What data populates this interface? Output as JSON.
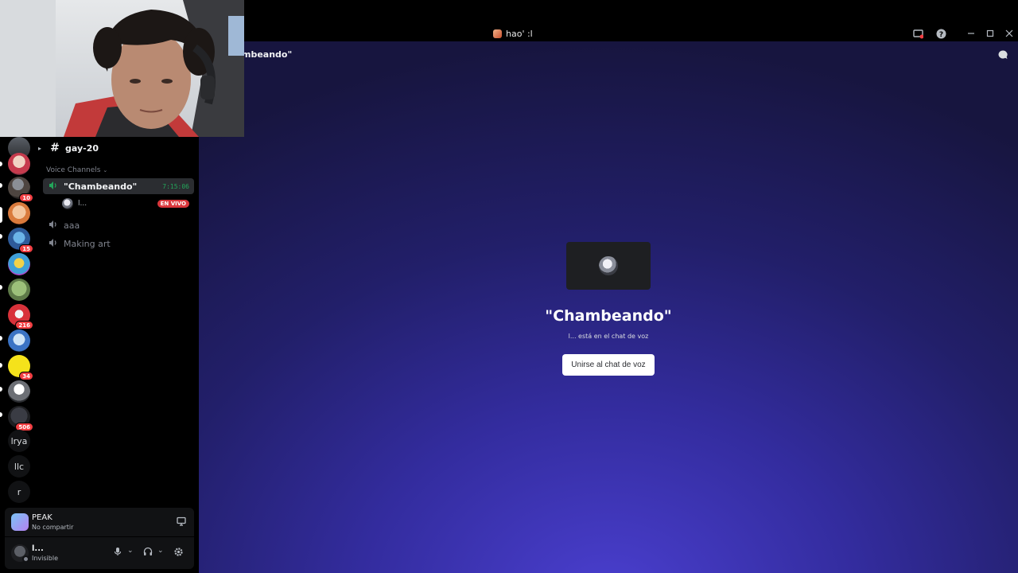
{
  "window": {
    "title": "hao' :l"
  },
  "titlebar": {
    "controls": [
      "inbox-icon",
      "help-icon",
      "minimize-icon",
      "maximize-icon",
      "close-icon"
    ]
  },
  "servers": {
    "badges": [
      "10",
      "15",
      "216",
      "34",
      "506"
    ],
    "text_servers": [
      "lrya",
      "llc",
      "r"
    ]
  },
  "channels": {
    "text_channel": "gay-20",
    "voice_header": "Voice Channels",
    "voice_channels": [
      {
        "name": "\"Chambeando\"",
        "timer": "7:15:06",
        "active": true
      },
      {
        "name": "aaa"
      },
      {
        "name": "Making art"
      }
    ],
    "stream_user": {
      "name": "l...",
      "live_label": "EN VIVO"
    }
  },
  "activity": {
    "name": "PEAK",
    "status": "No compartir"
  },
  "user": {
    "name": "l...",
    "status": "Invisible"
  },
  "main": {
    "header_title": "mbeando\"",
    "voice_title": "\"Chambeando\"",
    "voice_subtitle": "l... está en el chat de voz",
    "join_button": "Unirse al chat de voz"
  },
  "colors": {
    "accent": "#5865f2",
    "live": "#da373c",
    "timer": "#23a55a",
    "badge": "#f23f43"
  }
}
